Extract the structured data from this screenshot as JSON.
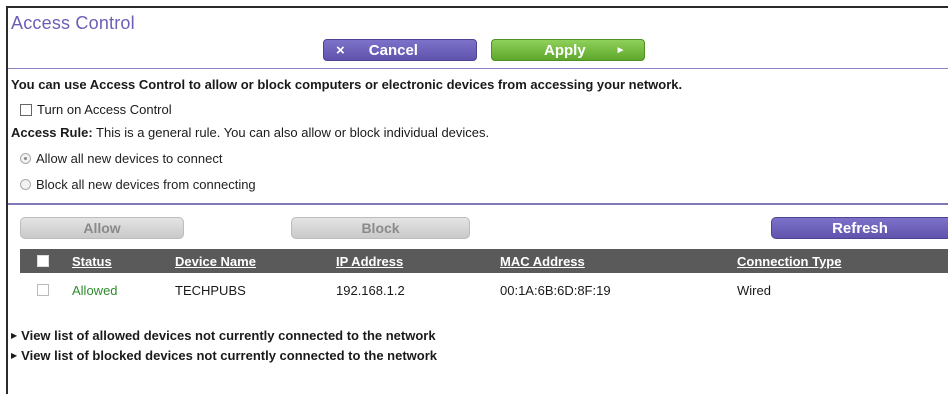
{
  "page": {
    "title": "Access Control"
  },
  "toolbar": {
    "cancel_icon": "×",
    "cancel_label": "Cancel",
    "apply_label": "Apply",
    "apply_icon": "►"
  },
  "intro_text": "You can use Access Control to allow or block computers or electronic devices from accessing your network.",
  "turn_on": {
    "label": "Turn on Access Control",
    "checked": false
  },
  "access_rule": {
    "label": "Access Rule:",
    "text": " This is a general rule. You can also allow or block individual devices."
  },
  "rule_options": [
    {
      "label": "Allow all new devices to connect",
      "selected": true
    },
    {
      "label": "Block all new devices from connecting",
      "selected": false
    }
  ],
  "actions": {
    "allow_label": "Allow",
    "block_label": "Block",
    "refresh_label": "Refresh"
  },
  "table": {
    "columns": [
      "Status",
      "Device Name",
      "IP Address",
      "MAC Address",
      "Connection Type"
    ],
    "rows": [
      [
        "Allowed",
        "TECHPUBS",
        "192.168.1.2",
        "00:1A:6B:6D:8F:19",
        "Wired"
      ]
    ]
  },
  "links": {
    "allowed": "View list of allowed devices not currently connected to the network",
    "blocked": "View list of blocked devices not currently connected to the network",
    "expand_icon": "▶"
  },
  "colors": {
    "title": "#6b5fb5",
    "cancel_button": "#6a5fb8",
    "apply_button": "#76bc42",
    "table_header": "#5a5a5a",
    "status_allowed": "#2e8b2e"
  }
}
